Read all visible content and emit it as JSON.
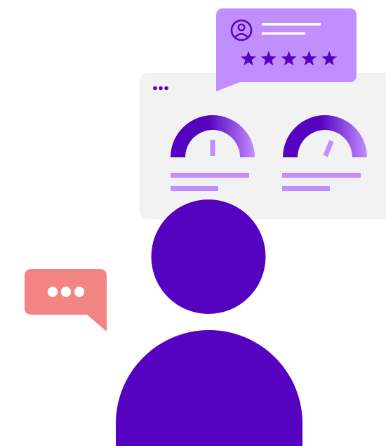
{
  "review_bubble": {
    "icon": "user-circle-icon",
    "rating": 5,
    "rating_max": 5,
    "star_icon": "star-icon"
  },
  "dashboard_card": {
    "menu_icon": "more-dots-icon",
    "gauges": [
      {
        "name": "gauge-left",
        "level": 0.5
      },
      {
        "name": "gauge-right",
        "level": 0.62
      }
    ]
  },
  "chat_bubble": {
    "icon": "typing-dots-icon"
  },
  "person": {
    "icon": "user-silhouette-icon"
  },
  "colors": {
    "primary": "#5503c1",
    "accent_light": "#c18efe",
    "card_bg": "#f2f2f2",
    "chat_bubble": "#f38484",
    "white": "#ffffff"
  }
}
